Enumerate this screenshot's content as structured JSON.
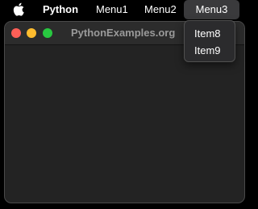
{
  "menubar": {
    "apple_icon": "apple-logo-icon",
    "app_name": "Python",
    "menus": [
      {
        "label": "Menu1"
      },
      {
        "label": "Menu2"
      },
      {
        "label": "Menu3"
      }
    ]
  },
  "window": {
    "title": "PythonExamples.org",
    "controls": {
      "close_color": "#fe5f57",
      "minimize_color": "#febc2e",
      "maximize_color": "#28c840"
    }
  },
  "dropdown": {
    "open_menu": "Menu3",
    "items": [
      {
        "label": "Item8"
      },
      {
        "label": "Item9"
      }
    ]
  }
}
